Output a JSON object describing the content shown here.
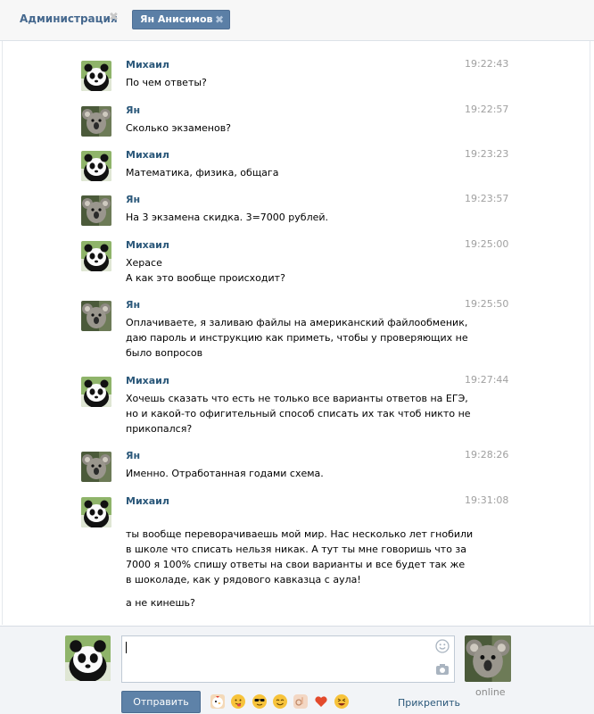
{
  "tabs": {
    "admin_label": "Администрация",
    "active_label": "Ян Анисимов",
    "close_glyph": "✖"
  },
  "messages": [
    {
      "author": "Михаил",
      "time": "19:22:43",
      "avatar": "panda",
      "lines": [
        "По чем ответы?"
      ]
    },
    {
      "author": "Ян",
      "time": "19:22:57",
      "avatar": "koala",
      "lines": [
        "Сколько экзаменов?"
      ]
    },
    {
      "author": "Михаил",
      "time": "19:23:23",
      "avatar": "panda",
      "lines": [
        "Математика, физика, общага"
      ]
    },
    {
      "author": "Ян",
      "time": "19:23:57",
      "avatar": "koala",
      "lines": [
        "На 3 экзамена скидка. 3=7000 рублей."
      ]
    },
    {
      "author": "Михаил",
      "time": "19:25:00",
      "avatar": "panda",
      "lines": [
        "Херасе",
        "А как это вообще происходит?"
      ]
    },
    {
      "author": "Ян",
      "time": "19:25:50",
      "avatar": "koala",
      "lines": [
        "Оплачиваете, я заливаю файлы на американский файлообменик,",
        "даю пароль и инструкцию как приметь, чтобы у проверяющих не",
        "было вопросов"
      ]
    },
    {
      "author": "Михаил",
      "time": "19:27:44",
      "avatar": "panda",
      "lines": [
        "Хочешь сказать что есть не только все варианты ответов на ЕГЭ,",
        "но и какой-то офигительный способ списать их так чтоб никто не",
        "прикопался?"
      ]
    },
    {
      "author": "Ян",
      "time": "19:28:26",
      "avatar": "koala",
      "lines": [
        "Именно. Отработанная годами схема."
      ]
    },
    {
      "author": "Михаил",
      "time": "19:31:08",
      "avatar": "panda",
      "lines": [
        "ты вообще переворачиваешь мой мир. Нас несколько лет гнобили",
        "в школе что списать нельзя никак. А тут ты мне говоришь что за",
        "7000 я 100% спишу ответы на свои варианты и все будет так же",
        "в шоколаде, как у рядового кавказца с аула!",
        "а не кинешь?"
      ]
    }
  ],
  "composer": {
    "input_value": "",
    "send_label": "Отправить",
    "attach_label": "Прикрепить",
    "status": "online"
  },
  "emojis": [
    "chicken",
    "tongue-face",
    "sunglasses-face",
    "smile-face",
    "ok-hand",
    "heart",
    "laughing-face"
  ],
  "colors": {
    "accent": "#5b7fa6",
    "author": "#2b587a",
    "time": "#a0a0a0"
  }
}
